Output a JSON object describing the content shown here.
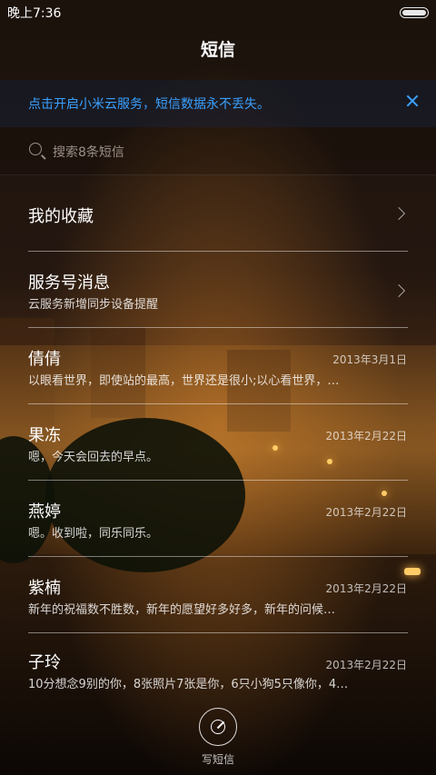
{
  "status": {
    "time": "晚上7:36"
  },
  "header": {
    "title": "短信"
  },
  "banner": {
    "text": "点击开启小米云服务，短信数据永不丢失。"
  },
  "search": {
    "placeholder": "搜索8条短信"
  },
  "list": {
    "favorites": {
      "title": "我的收藏"
    },
    "service": {
      "title": "服务号消息",
      "subtitle": "云服务新增同步设备提醒"
    },
    "conversations": [
      {
        "name": "倩倩",
        "date": "2013年3月1日",
        "preview": "以眼看世界，即使站的最高，世界还是很小;以心看世界，…"
      },
      {
        "name": "果冻",
        "date": "2013年2月22日",
        "preview": "嗯，今天会回去的早点。"
      },
      {
        "name": "燕婷",
        "date": "2013年2月22日",
        "preview": "嗯。收到啦，同乐同乐。"
      },
      {
        "name": "紫楠",
        "date": "2013年2月22日",
        "preview": "新年的祝福数不胜数，新年的愿望好多好多，新年的问候…"
      },
      {
        "name": "子玲",
        "date": "2013年2月22日",
        "preview": "10分想念9别的你，8张照片7张是你，6只小狗5只像你，4…"
      }
    ]
  },
  "footer": {
    "compose_label": "写短信"
  },
  "colors": {
    "accent": "#3aa0ff"
  }
}
